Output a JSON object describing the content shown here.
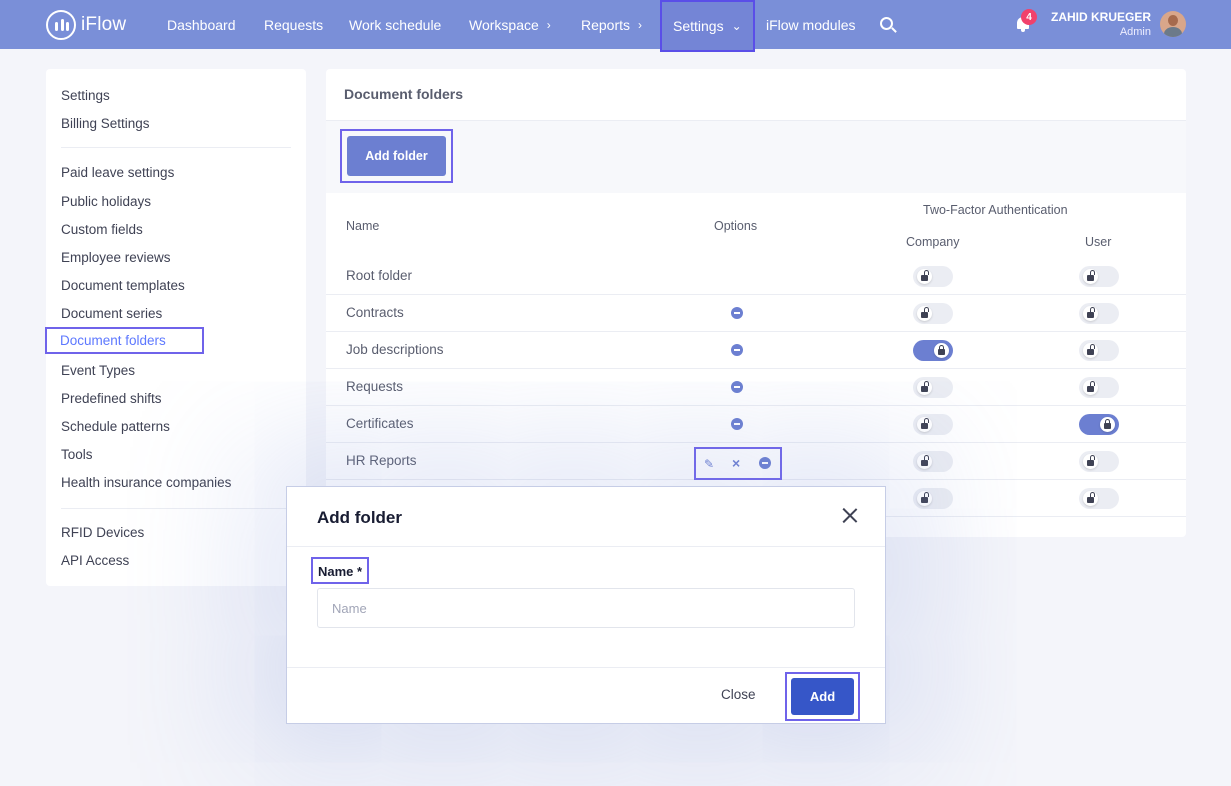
{
  "app": {
    "logo_text": "iFlow"
  },
  "nav": {
    "items": [
      {
        "label": "Dashboard"
      },
      {
        "label": "Requests"
      },
      {
        "label": "Work schedule"
      },
      {
        "label": "Workspace"
      },
      {
        "label": "Reports"
      },
      {
        "label": "Settings"
      },
      {
        "label": "iFlow modules"
      }
    ],
    "notification_count": "4",
    "user_name": "ZAHID KRUEGER",
    "user_role": "Admin"
  },
  "sidebar": {
    "items": [
      "Settings",
      "Billing Settings",
      "Paid leave settings",
      "Public holidays",
      "Custom fields",
      "Employee reviews",
      "Document templates",
      "Document series",
      "Document folders",
      "Event Types",
      "Predefined shifts",
      "Schedule patterns",
      "Tools",
      "Health insurance companies",
      "RFID Devices",
      "API Access"
    ]
  },
  "main": {
    "title": "Document folders",
    "add_folder_label": "Add folder",
    "columns": {
      "name": "Name",
      "options": "Options",
      "tfa": "Two-Factor Authentication",
      "company": "Company",
      "user": "User"
    },
    "rows": [
      {
        "name": "Root folder",
        "company_2fa": false,
        "user_2fa": false
      },
      {
        "name": "Contracts",
        "company_2fa": false,
        "user_2fa": false
      },
      {
        "name": "Job descriptions",
        "company_2fa": true,
        "user_2fa": false
      },
      {
        "name": "Requests",
        "company_2fa": false,
        "user_2fa": false
      },
      {
        "name": "Certificates",
        "company_2fa": false,
        "user_2fa": true
      },
      {
        "name": "HR Reports",
        "company_2fa": false,
        "user_2fa": false
      },
      {
        "name": "",
        "company_2fa": false,
        "user_2fa": false
      }
    ]
  },
  "modal": {
    "title": "Add folder",
    "name_label": "Name *",
    "name_placeholder": "Name",
    "name_value": "",
    "close_label": "Close",
    "add_label": "Add"
  },
  "colors": {
    "nav_bg": "#7a8fd8",
    "accent": "#6c7fd1",
    "primary_button": "#3656c8",
    "highlight": "#6f63ea",
    "badge": "#f1416c"
  }
}
